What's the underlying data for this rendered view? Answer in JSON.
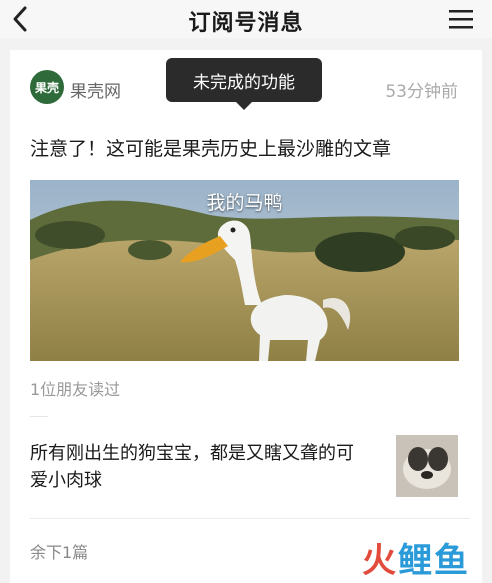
{
  "navbar": {
    "title": "订阅号消息",
    "back_icon": "chevron-left-icon",
    "menu_icon": "hamburger-menu-icon"
  },
  "article": {
    "account_avatar_text": "果壳",
    "account_name": "果壳网",
    "time_ago": "53分钟前",
    "tooltip": "未完成的功能",
    "headline": "注意了！这可能是果壳历史上最沙雕的文章",
    "image_caption": "我的马鸭",
    "readers": "1位朋友读过"
  },
  "item2": {
    "title": "所有刚出生的狗宝宝，都是又瞎又聋的可爱小肉球"
  },
  "footer": {
    "remaining": "余下1篇"
  },
  "watermark": {
    "part1": "火",
    "part2": "鲤鱼"
  },
  "colors": {
    "watermark_red": "#e24b3b",
    "watermark_blue": "#2a9ad8",
    "tooltip_bg": "#2b2b2b"
  }
}
